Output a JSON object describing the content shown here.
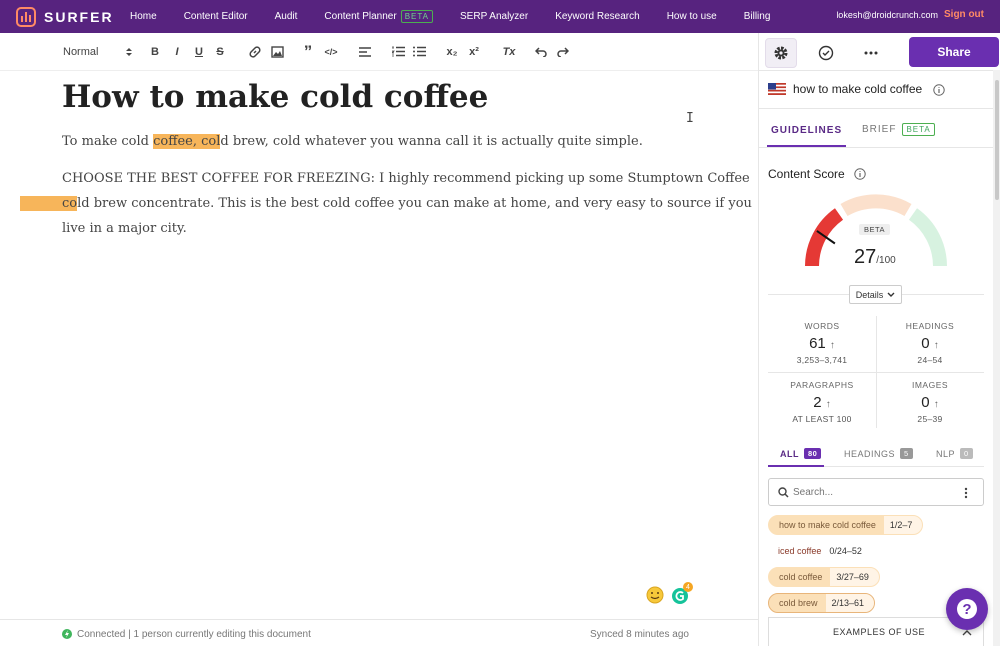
{
  "brand": {
    "name": "SURFER",
    "accent": "#57237f",
    "orange": "#ff8a65"
  },
  "nav": {
    "items": [
      "Home",
      "Content Editor",
      "Audit",
      "Content Planner",
      "SERP Analyzer",
      "Keyword Research",
      "How to use",
      "Billing"
    ],
    "planner_badge": "BETA",
    "user_email": "lokesh@droidcrunch.com",
    "signout_label": "Sign out"
  },
  "toolbar": {
    "format_select": "Normal",
    "bold": "B",
    "italic": "I",
    "underline": "U",
    "strike": "S",
    "quote": "”",
    "code": "</>",
    "subscript": "x₂",
    "superscript": "x²",
    "clear_format": "Tx"
  },
  "document": {
    "title": "How to make cold coffee",
    "para1_before": "To make cold ",
    "para1_hl": "coffee, col",
    "para1_after": "d brew, cold whatever you wanna call it is actually quite simple.",
    "para2_line1": "CHOOSE THE BEST COFFEE FOR FREEZING:  I highly recommend picking up some Stumptown Coffee",
    "para2_hl": "co",
    "para2_line2_rest": "ld brew concentrate. This is the best cold coffee you can make at home, and very easy to source if you",
    "para2_line3": "live in a major city."
  },
  "footer": {
    "status": "Connected | 1 person currently editing this document",
    "sync": "Synced 8 minutes ago"
  },
  "grammarly_count": "4",
  "panel": {
    "share_label": "Share",
    "keyword": "how to make cold coffee",
    "tabs": {
      "guidelines": "GUIDELINES",
      "brief": "BRIEF",
      "brief_badge": "BETA"
    },
    "content_score": {
      "label": "Content Score",
      "badge": "BETA",
      "score": "27",
      "max": "/100",
      "score_value": 27,
      "details_label": "Details"
    },
    "stats": [
      {
        "label": "WORDS",
        "value": "61",
        "range": "3,253–3,741"
      },
      {
        "label": "HEADINGS",
        "value": "0",
        "range": "24–54"
      },
      {
        "label": "PARAGRAPHS",
        "value": "2",
        "range": "AT LEAST 100"
      },
      {
        "label": "IMAGES",
        "value": "0",
        "range": "25–39"
      }
    ],
    "filters": [
      {
        "label": "ALL",
        "count": "80"
      },
      {
        "label": "HEADINGS",
        "count": "5"
      },
      {
        "label": "NLP",
        "count": "0"
      }
    ],
    "search_placeholder": "Search...",
    "keywords": [
      {
        "term": "how to make cold coffee",
        "count": "1/2–7"
      },
      {
        "term": "iced coffee",
        "count": "0/24–52"
      },
      {
        "term": "cold coffee",
        "count": "3/27–69"
      },
      {
        "term": "cold brew",
        "count": "2/13–61"
      }
    ],
    "examples_label": "EXAMPLES OF USE"
  }
}
